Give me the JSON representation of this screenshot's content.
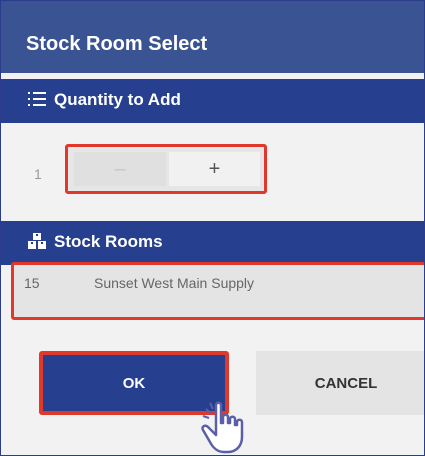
{
  "dialog": {
    "title": "Stock Room Select"
  },
  "quantity_section": {
    "icon": "list-icon",
    "label": "Quantity to Add",
    "value": "1",
    "stepper": {
      "minus_label": "–",
      "plus_label": "+"
    }
  },
  "stockrooms_section": {
    "icon": "warehouse-boxes-icon",
    "label": "Stock Rooms",
    "rows": [
      {
        "number": "15",
        "name": "Sunset West Main Supply"
      }
    ]
  },
  "buttons": {
    "ok_label": "OK",
    "cancel_label": "CANCEL"
  },
  "colors": {
    "title_bar": "#3a5493",
    "section_header": "#26408f",
    "ok_button": "#263f8f",
    "highlight_border": "#e0392b"
  },
  "overlay": {
    "cursor_icon": "hand-pointer-icon"
  }
}
